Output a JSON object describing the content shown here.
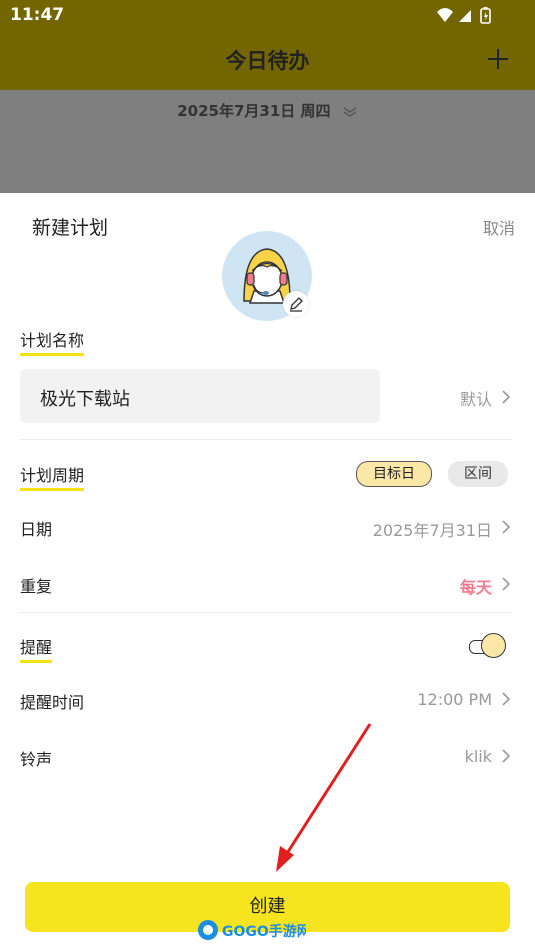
{
  "status_bar": {
    "time": "11:47"
  },
  "header": {
    "title": "今日待办",
    "date": "2025年7月31日 周四"
  },
  "sheet": {
    "title": "新建计划",
    "cancel_label": "取消",
    "plan_name": {
      "label": "计划名称",
      "value": "极光下载站",
      "default_label": "默认"
    },
    "plan_cycle": {
      "label": "计划周期",
      "options": [
        "目标日",
        "区间"
      ],
      "selected": "目标日"
    },
    "date": {
      "label": "日期",
      "value": "2025年7月31日"
    },
    "repeat": {
      "label": "重复",
      "value": "每天"
    },
    "reminder": {
      "label": "提醒",
      "enabled": true
    },
    "reminder_time": {
      "label": "提醒时间",
      "value": "12:00 PM"
    },
    "ringtone": {
      "label": "铃声",
      "value": "klik"
    },
    "create_label": "创建"
  },
  "watermark": {
    "text": "GOGO手游网"
  },
  "colors": {
    "accent": "#f6e41e",
    "repeat": "#f27c8f",
    "header_bg": "#736600"
  }
}
